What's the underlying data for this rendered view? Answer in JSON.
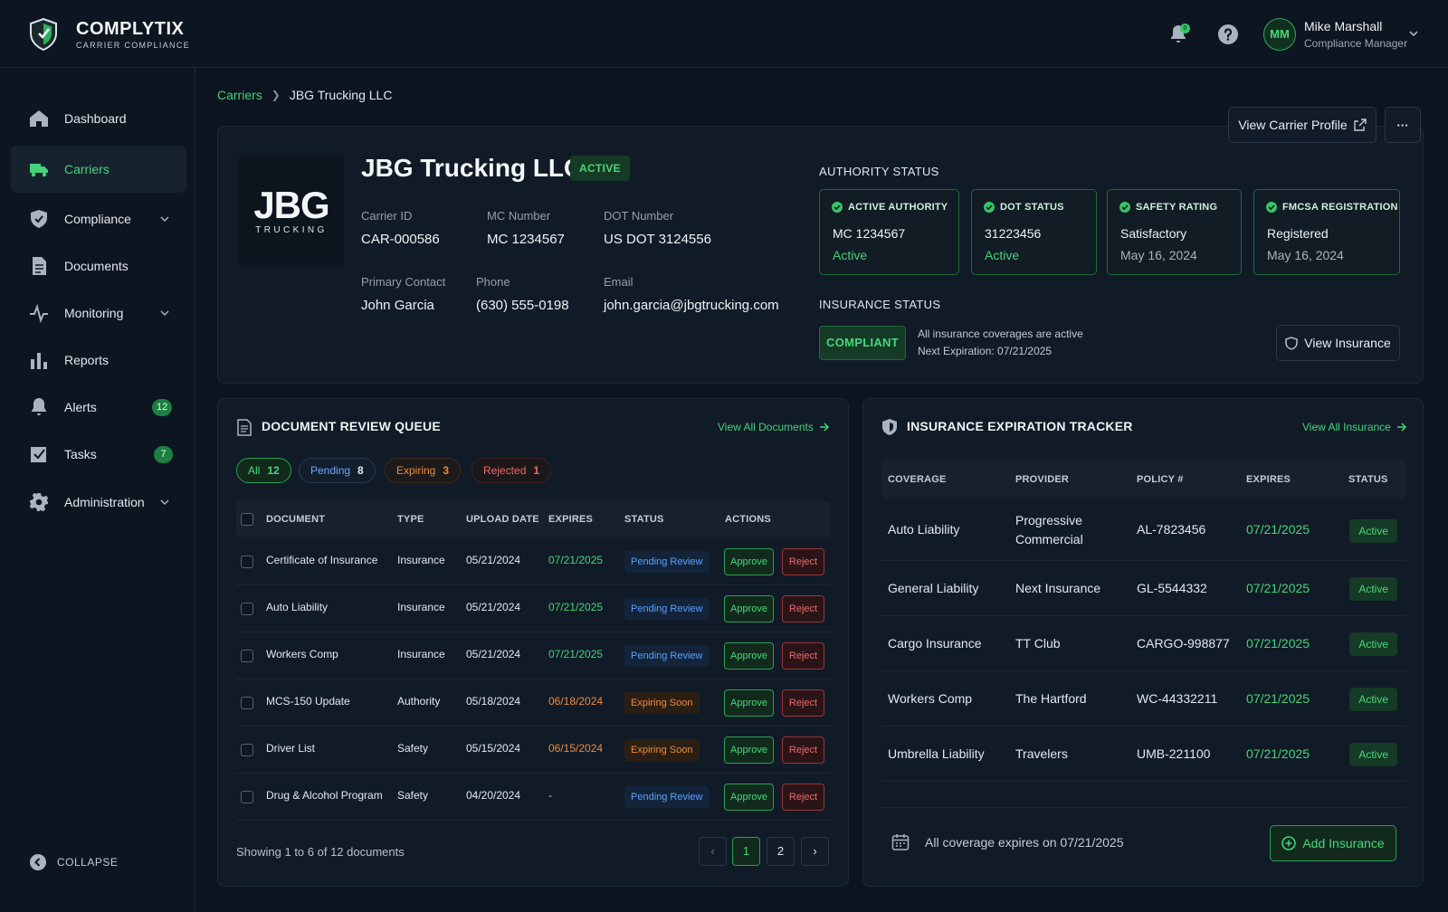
{
  "brand": {
    "name": "COMPLYTIX",
    "sub": "CARRIER COMPLIANCE"
  },
  "header": {
    "notif_count": "0",
    "user": {
      "initials": "MM",
      "name": "Mike Marshall",
      "role": "Compliance Manager"
    }
  },
  "sidebar": {
    "items": [
      {
        "label": "Dashboard"
      },
      {
        "label": "Carriers"
      },
      {
        "label": "Compliance"
      },
      {
        "label": "Documents"
      },
      {
        "label": "Monitoring"
      },
      {
        "label": "Reports"
      },
      {
        "label": "Alerts",
        "badge": "12"
      },
      {
        "label": "Tasks",
        "badge": "7"
      },
      {
        "label": "Administration"
      }
    ],
    "collapse": "COLLAPSE"
  },
  "breadcrumb": {
    "root": "Carriers",
    "current": "JBG Trucking LLC"
  },
  "actions": {
    "view_profile": "View Carrier Profile",
    "more": "···"
  },
  "carrier": {
    "logo_big": "JBG",
    "logo_small": "TRUCKING",
    "name": "JBG Trucking LLC",
    "status": "ACTIVE",
    "fields": [
      {
        "label": "Carrier ID",
        "value": "CAR-000586"
      },
      {
        "label": "MC Number",
        "value": "MC 1234567"
      },
      {
        "label": "DOT Number",
        "value": "US DOT 3124556"
      },
      {
        "label": "Primary Contact",
        "value": "John Garcia"
      },
      {
        "label": "Phone",
        "value": "(630) 555-0198"
      },
      {
        "label": "Email",
        "value": "john.garcia@jbgtrucking.com"
      }
    ]
  },
  "authority": {
    "title": "AUTHORITY STATUS",
    "cards": [
      {
        "head": "ACTIVE AUTHORITY",
        "value": "MC 1234567",
        "sub": "Active"
      },
      {
        "head": "DOT STATUS",
        "value": "31223456",
        "sub": "Active"
      },
      {
        "head": "SAFETY RATING",
        "value": "Satisfactory",
        "sub": "May 16, 2024"
      },
      {
        "head": "FMCSA REGISTRATION",
        "value": "Registered",
        "sub": "May 16, 2024"
      }
    ]
  },
  "insurance_status": {
    "title": "INSURANCE STATUS",
    "badge": "COMPLIANT",
    "line1": "All insurance coverages are active",
    "line2": "Next Expiration: 07/21/2025",
    "button": "View Insurance"
  },
  "queue": {
    "title": "DOCUMENT REVIEW QUEUE",
    "link": "View All Documents",
    "filters": [
      {
        "label": "All",
        "count": "12"
      },
      {
        "label": "Pending",
        "count": "8"
      },
      {
        "label": "Expiring",
        "count": "3"
      },
      {
        "label": "Rejected",
        "count": "1"
      }
    ],
    "columns": [
      "DOCUMENT",
      "TYPE",
      "UPLOAD DATE",
      "EXPIRES",
      "STATUS",
      "ACTIONS"
    ],
    "approve": "Approve",
    "reject": "Reject",
    "rows": [
      {
        "doc": "Certificate of Insurance",
        "type": "Insurance",
        "upload": "05/21/2024",
        "expires": "07/21/2025",
        "status": "Pending Review"
      },
      {
        "doc": "Auto Liability",
        "type": "Insurance",
        "upload": "05/21/2024",
        "expires": "07/21/2025",
        "status": "Pending Review"
      },
      {
        "doc": "Workers Comp",
        "type": "Insurance",
        "upload": "05/21/2024",
        "expires": "07/21/2025",
        "status": "Pending Review"
      },
      {
        "doc": "MCS-150 Update",
        "type": "Authority",
        "upload": "05/18/2024",
        "expires": "06/18/2024",
        "status": "Expiring Soon"
      },
      {
        "doc": "Driver List",
        "type": "Safety",
        "upload": "05/15/2024",
        "expires": "06/15/2024",
        "status": "Expiring Soon"
      },
      {
        "doc": "Drug & Alcohol Program",
        "type": "Safety",
        "upload": "04/20/2024",
        "expires": "-",
        "status": "Pending Review"
      }
    ],
    "footer": "Showing 1 to 6 of 12 documents",
    "pages": [
      "1",
      "2"
    ]
  },
  "tracker": {
    "title": "INSURANCE EXPIRATION TRACKER",
    "link": "View All Insurance",
    "columns": [
      "COVERAGE",
      "PROVIDER",
      "POLICY #",
      "EXPIRES",
      "STATUS"
    ],
    "rows": [
      {
        "coverage": "Auto Liability",
        "provider1": "Progressive",
        "provider2": "Commercial",
        "policy": "AL-7823456",
        "expires": "07/21/2025",
        "status": "Active"
      },
      {
        "coverage": "General Liability",
        "provider1": "Next Insurance",
        "provider2": "",
        "policy": "GL-5544332",
        "expires": "07/21/2025",
        "status": "Active"
      },
      {
        "coverage": "Cargo Insurance",
        "provider1": "TT Club",
        "provider2": "",
        "policy": "CARGO-998877",
        "expires": "07/21/2025",
        "status": "Active"
      },
      {
        "coverage": "Workers Comp",
        "provider1": "The Hartford",
        "provider2": "",
        "policy": "WC-44332211",
        "expires": "07/21/2025",
        "status": "Active"
      },
      {
        "coverage": "Umbrella Liability",
        "provider1": "Travelers",
        "provider2": "",
        "policy": "UMB-221100",
        "expires": "07/21/2025",
        "status": "Active"
      }
    ],
    "footer": "All coverage expires on 07/21/2025",
    "add_button": "Add Insurance"
  },
  "colors": {
    "accent": "#46d27a",
    "background": "#0c1420",
    "panel": "#111b27",
    "pending": "#5aa0ff",
    "expiring": "#f08a3c",
    "reject": "#ef6a6a"
  }
}
